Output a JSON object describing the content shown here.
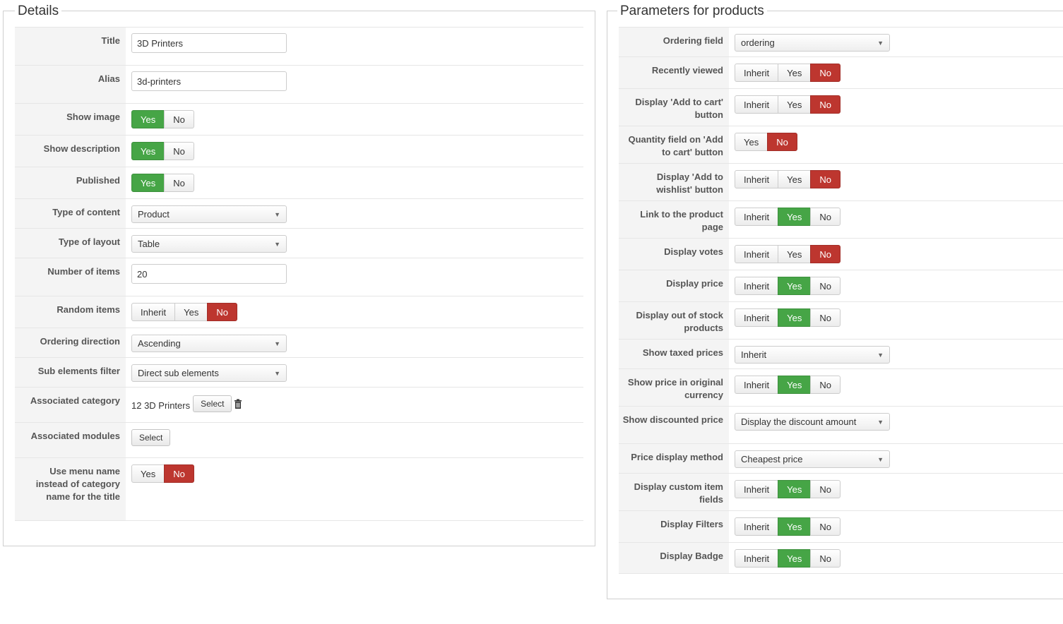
{
  "details": {
    "legend": "Details",
    "title": {
      "label": "Title",
      "value": "3D Printers"
    },
    "alias": {
      "label": "Alias",
      "value": "3d-printers"
    },
    "show_image": {
      "label": "Show image",
      "yes": "Yes",
      "no": "No",
      "selected": "Yes"
    },
    "show_description": {
      "label": "Show description",
      "yes": "Yes",
      "no": "No",
      "selected": "Yes"
    },
    "published": {
      "label": "Published",
      "yes": "Yes",
      "no": "No",
      "selected": "Yes"
    },
    "type_of_content": {
      "label": "Type of content",
      "value": "Product"
    },
    "type_of_layout": {
      "label": "Type of layout",
      "value": "Table"
    },
    "number_of_items": {
      "label": "Number of items",
      "value": "20"
    },
    "random_items": {
      "label": "Random items",
      "inherit": "Inherit",
      "yes": "Yes",
      "no": "No",
      "selected": "No"
    },
    "ordering_direction": {
      "label": "Ordering direction",
      "value": "Ascending"
    },
    "sub_elements_filter": {
      "label": "Sub elements filter",
      "value": "Direct sub elements"
    },
    "associated_category": {
      "label": "Associated category",
      "value": "12 3D Printers",
      "select_label": "Select"
    },
    "associated_modules": {
      "label": "Associated modules",
      "select_label": "Select"
    },
    "use_menu_name": {
      "label": "Use menu name instead of category name for the title",
      "yes": "Yes",
      "no": "No",
      "selected": "No"
    }
  },
  "params": {
    "legend": "Parameters for products",
    "ordering_field": {
      "label": "Ordering field",
      "value": "ordering"
    },
    "recently_viewed": {
      "label": "Recently viewed",
      "inherit": "Inherit",
      "yes": "Yes",
      "no": "No",
      "selected": "No"
    },
    "display_add_to_cart": {
      "label": "Display 'Add to cart' button",
      "inherit": "Inherit",
      "yes": "Yes",
      "no": "No",
      "selected": "No"
    },
    "quantity_field": {
      "label": "Quantity field on 'Add to cart' button",
      "yes": "Yes",
      "no": "No",
      "selected": "No"
    },
    "display_add_to_wishlist": {
      "label": "Display 'Add to wishlist' button",
      "inherit": "Inherit",
      "yes": "Yes",
      "no": "No",
      "selected": "No"
    },
    "link_to_product": {
      "label": "Link to the product page",
      "inherit": "Inherit",
      "yes": "Yes",
      "no": "No",
      "selected": "Yes"
    },
    "display_votes": {
      "label": "Display votes",
      "inherit": "Inherit",
      "yes": "Yes",
      "no": "No",
      "selected": "No"
    },
    "display_price": {
      "label": "Display price",
      "inherit": "Inherit",
      "yes": "Yes",
      "no": "No",
      "selected": "Yes"
    },
    "display_out_of_stock": {
      "label": "Display out of stock products",
      "inherit": "Inherit",
      "yes": "Yes",
      "no": "No",
      "selected": "Yes"
    },
    "show_taxed_prices": {
      "label": "Show taxed prices",
      "value": "Inherit"
    },
    "show_price_original_currency": {
      "label": "Show price in original currency",
      "inherit": "Inherit",
      "yes": "Yes",
      "no": "No",
      "selected": "Yes"
    },
    "show_discounted_price": {
      "label": "Show discounted price",
      "value": "Display the discount amount"
    },
    "price_display_method": {
      "label": "Price display method",
      "value": "Cheapest price"
    },
    "display_custom_item_fields": {
      "label": "Display custom item fields",
      "inherit": "Inherit",
      "yes": "Yes",
      "no": "No",
      "selected": "Yes"
    },
    "display_filters": {
      "label": "Display Filters",
      "inherit": "Inherit",
      "yes": "Yes",
      "no": "No",
      "selected": "Yes"
    },
    "display_badge": {
      "label": "Display Badge",
      "inherit": "Inherit",
      "yes": "Yes",
      "no": "No",
      "selected": "Yes"
    }
  },
  "colors": {
    "yes_active": "#46a546",
    "no_active": "#bd362f"
  },
  "icons": {
    "trash": "trash-icon",
    "dropdown": "chevron-down-icon"
  }
}
